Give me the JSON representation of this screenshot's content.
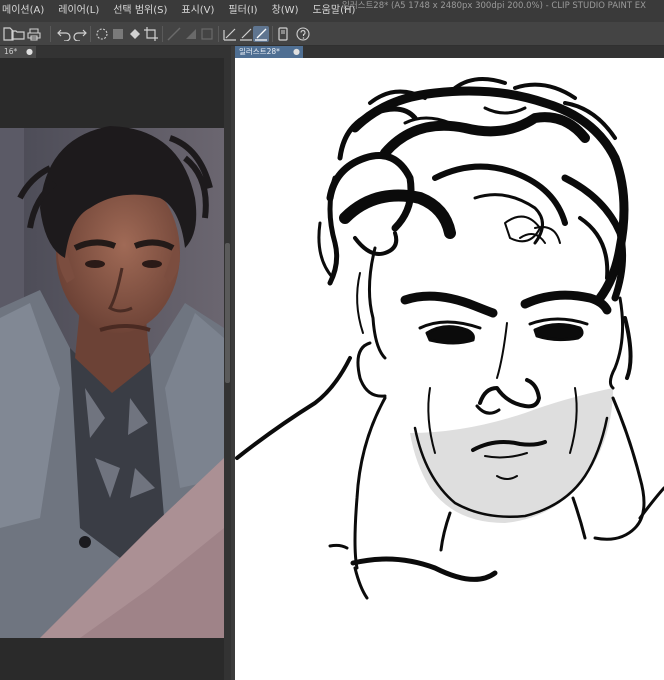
{
  "window": {
    "title": "일러스트28* (A5 1748 x 2480px 300dpi 200.0%)  - CLIP STUDIO PAINT EX"
  },
  "menu": {
    "items": [
      {
        "label": "메이션(A)"
      },
      {
        "label": "레이어(L)"
      },
      {
        "label": "선택 범위(S)"
      },
      {
        "label": "표시(V)"
      },
      {
        "label": "필터(I)"
      },
      {
        "label": "창(W)"
      },
      {
        "label": "도움말(H)"
      }
    ]
  },
  "toolbar": {
    "icons": [
      "new-file-icon",
      "open-folder-icon",
      "print-icon",
      "undo-icon",
      "redo-icon",
      "clear-selection-icon",
      "transform-icon",
      "fill-icon",
      "crop-icon",
      "ruler-icon",
      "shape-icon",
      "snap-icon",
      "pen-tool-icon",
      "brush-tool-icon",
      "active-brush-icon",
      "device-icon",
      "help-icon"
    ]
  },
  "tabs": {
    "left": {
      "label": "16*",
      "close": "●"
    },
    "right": {
      "label": "일러스트28*",
      "close": "●"
    }
  },
  "colors": {
    "accent": "#4f6f93",
    "canvas_bg": "#ffffff",
    "panel_bg": "#2b2b2b"
  }
}
